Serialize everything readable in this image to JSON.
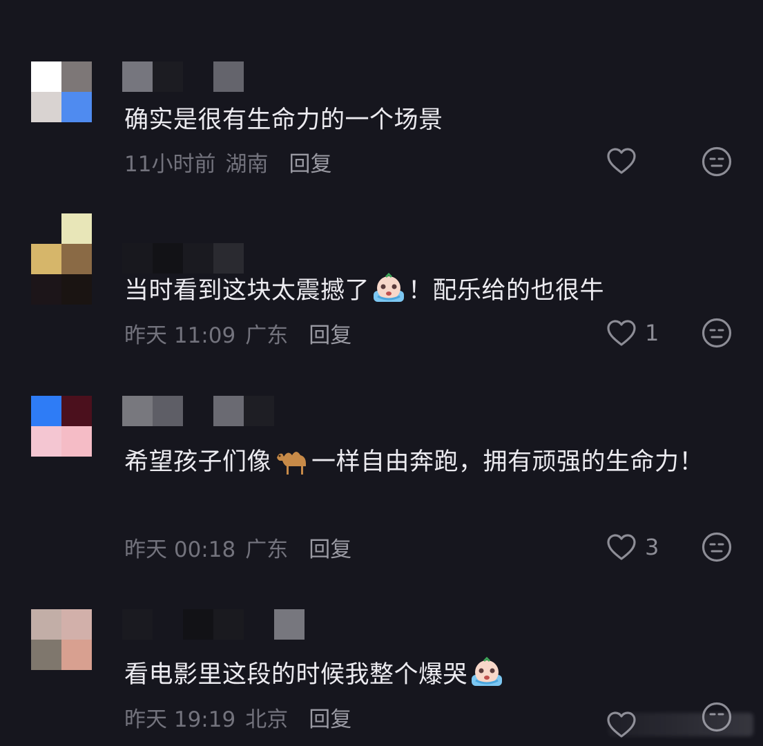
{
  "comments": [
    {
      "text": "确实是很有生命力的一个场景",
      "time": "11小时前",
      "location": "湖南",
      "reply": "回复",
      "likes": ""
    },
    {
      "text_before": "当时看到这块太震撼了",
      "text_after": "！配乐给的也很牛",
      "emoji": "crying-face-emoji",
      "time": "昨天 11:09",
      "location": "广东",
      "reply": "回复",
      "likes": "1"
    },
    {
      "text_before": "希望孩子们像",
      "text_after": "一样自由奔跑，拥有顽强的生命力！",
      "emoji": "camel-emoji",
      "time": "昨天 00:18",
      "location": "广东",
      "reply": "回复",
      "likes": "3"
    },
    {
      "text_before": "看电影里这段的时候我整个爆哭",
      "text_after": "",
      "emoji": "crying-face-emoji",
      "time": "昨天 19:19",
      "location": "北京",
      "reply": "回复",
      "likes": ""
    }
  ],
  "colors": {
    "background": "#16161e",
    "text": "#ecebf0",
    "meta": "#73737d",
    "icon": "#8d8d96"
  }
}
